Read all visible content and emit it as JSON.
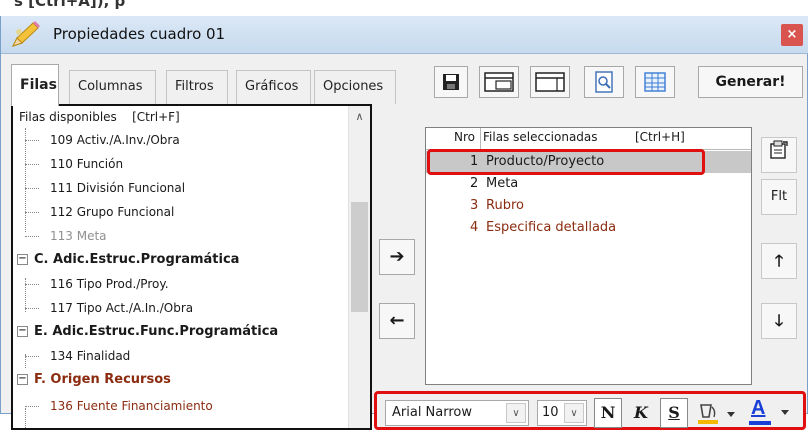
{
  "crop_text": "s [Ctrl+A]), p",
  "window": {
    "title": "Propiedades cuadro 01",
    "close_symbol": "×"
  },
  "tabs": [
    {
      "label": "Filas",
      "active": true
    },
    {
      "label": "Columnas"
    },
    {
      "label": "Filtros"
    },
    {
      "label": "Gráficos"
    },
    {
      "label": "Opciones"
    }
  ],
  "toolbar": {
    "icons": [
      "save-icon",
      "layout-icon",
      "window-icon",
      "preview-icon",
      "grid-icon"
    ],
    "generate_label": "Generar!"
  },
  "left_panel": {
    "header": "Filas disponibles    [Ctrl+F]",
    "items": [
      {
        "label": "109 Activ./A.Inv./Obra",
        "kind": "child",
        "color": "#1a1a1a"
      },
      {
        "label": "110 Función",
        "kind": "child",
        "color": "#1a1a1a"
      },
      {
        "label": "111 División Funcional",
        "kind": "child",
        "color": "#1a1a1a"
      },
      {
        "label": "112 Grupo Funcional",
        "kind": "child",
        "color": "#1a1a1a"
      },
      {
        "label": "113 Meta",
        "kind": "child",
        "color": "#909090"
      },
      {
        "label": "C. Adic.Estruc.Programática",
        "kind": "group",
        "color": "#1a1a1a"
      },
      {
        "label": "116 Tipo Prod./Proy.",
        "kind": "child",
        "color": "#1a1a1a"
      },
      {
        "label": "117 Tipo Act./A.In./Obra",
        "kind": "child",
        "color": "#1a1a1a"
      },
      {
        "label": "E. Adic.Estruc.Func.Programática",
        "kind": "group",
        "color": "#1a1a1a"
      },
      {
        "label": "134 Finalidad",
        "kind": "child",
        "color": "#1a1a1a"
      },
      {
        "label": "F. Origen Recursos",
        "kind": "group",
        "color": "#8b2c10"
      },
      {
        "label": "136 Fuente Financiamiento",
        "kind": "child",
        "color": "#8b2c10"
      }
    ],
    "expander_symbol": "−"
  },
  "move_buttons": {
    "right": "➔",
    "left": "←"
  },
  "right_panel": {
    "header_nro": "Nro",
    "header_title": "Filas seleccionadas",
    "header_shortcut": "[Ctrl+H]",
    "rows": [
      {
        "num": "1",
        "label": "Producto/Proyecto",
        "color": "#1a1a1a",
        "selected": true
      },
      {
        "num": "2",
        "label": "Meta",
        "color": "#1a1a1a"
      },
      {
        "num": "3",
        "label": "Rubro",
        "color": "#8b2c10"
      },
      {
        "num": "4",
        "label": "Especifica detallada",
        "color": "#8b2c10"
      }
    ]
  },
  "side_buttons": {
    "flt_label": "Flt",
    "up": "🡑",
    "down": "🡓"
  },
  "format_bar": {
    "font_name": "Arial Narrow",
    "font_size": "10",
    "bold_label": "N",
    "italic_label": "K",
    "strike_label": "S",
    "fill_color": "#f5b800",
    "font_color": "#1a3fd6",
    "font_color_letter": "A"
  }
}
